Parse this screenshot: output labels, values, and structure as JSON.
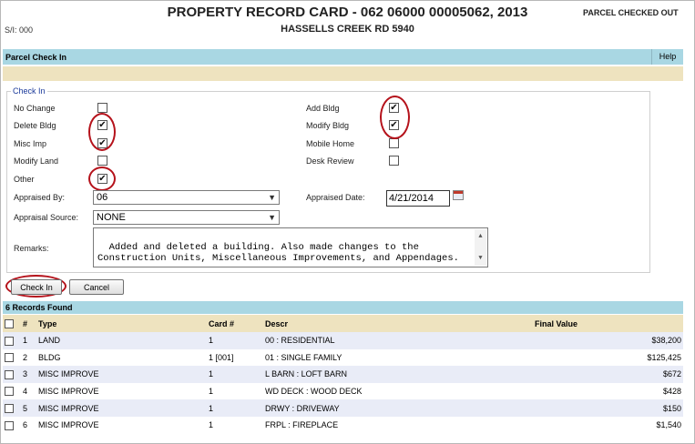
{
  "header": {
    "title": "PROPERTY RECORD CARD - 062 06000 00005062, 2013",
    "address": "HASSELLS CREEK RD 5940",
    "status": "PARCEL CHECKED OUT",
    "sl": "S/I: 000"
  },
  "panel": {
    "title": "Parcel Check In",
    "help": "Help"
  },
  "checkin": {
    "legend": "Check In",
    "left_items": [
      {
        "label": "No Change",
        "checked": false
      },
      {
        "label": "Delete Bldg",
        "checked": true
      },
      {
        "label": "Misc Imp",
        "checked": true
      },
      {
        "label": "Modify Land",
        "checked": false
      },
      {
        "label": "Other",
        "checked": true
      }
    ],
    "right_items": [
      {
        "label": "Add Bldg",
        "checked": true
      },
      {
        "label": "Modify Bldg",
        "checked": true
      },
      {
        "label": "Mobile Home",
        "checked": false
      },
      {
        "label": "Desk Review",
        "checked": false
      }
    ],
    "appraised_by_label": "Appraised By:",
    "appraised_by_value": "06",
    "appraised_date_label": "Appraised Date:",
    "appraised_date_value": "4/21/2014",
    "appraisal_source_label": "Appraisal Source:",
    "appraisal_source_value": "NONE",
    "remarks_label": "Remarks:",
    "remarks_value": "Added and deleted a building. Also made changes to the Construction Units, Miscellaneous Improvements, and Appendages."
  },
  "buttons": {
    "check_in": "Check In",
    "cancel": "Cancel"
  },
  "records": {
    "found": "6 Records Found",
    "headers": {
      "num": "#",
      "type": "Type",
      "card": "Card #",
      "descr": "Descr",
      "final_value": "Final Value"
    },
    "rows": [
      {
        "num": "1",
        "type": "LAND",
        "card": "1",
        "descr": "00 : RESIDENTIAL",
        "value": "$38,200"
      },
      {
        "num": "2",
        "type": "BLDG",
        "card": "1 [001]",
        "descr": "01 : SINGLE FAMILY",
        "value": "$125,425"
      },
      {
        "num": "3",
        "type": "MISC IMPROVE",
        "card": "1",
        "descr": "L BARN : LOFT BARN",
        "value": "$672"
      },
      {
        "num": "4",
        "type": "MISC IMPROVE",
        "card": "1",
        "descr": "WD DECK : WOOD DECK",
        "value": "$428"
      },
      {
        "num": "5",
        "type": "MISC IMPROVE",
        "card": "1",
        "descr": "DRWY : DRIVEWAY",
        "value": "$150"
      },
      {
        "num": "6",
        "type": "MISC IMPROVE",
        "card": "1",
        "descr": "FRPL : FIREPLACE",
        "value": "$1,540"
      }
    ]
  },
  "colors": {
    "panel_header": "#a9d7e3",
    "tan_bar": "#eee3bf",
    "alt_row": "#e9ecf7",
    "highlight_ring": "#b5121b"
  }
}
